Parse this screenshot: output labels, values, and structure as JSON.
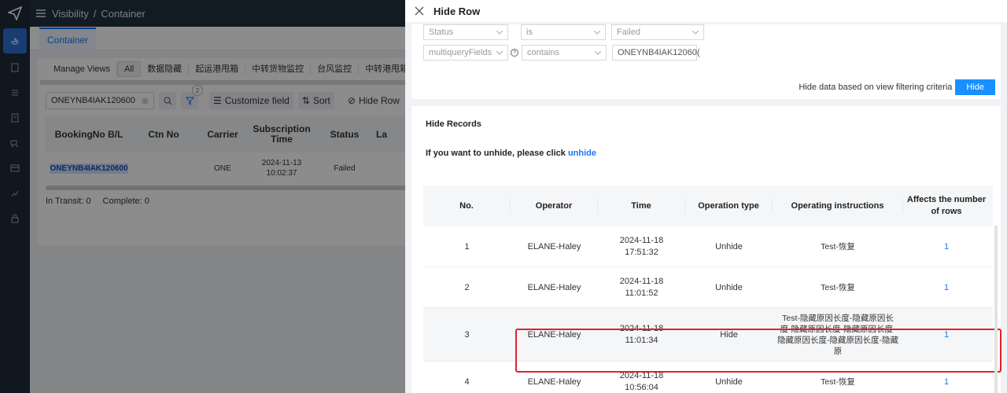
{
  "rail": {
    "icons": [
      "logo-plane-icon",
      "ship-icon",
      "document-icon",
      "list-icon",
      "file-icon",
      "truck-icon",
      "table-icon",
      "chart-icon",
      "lock-icon"
    ]
  },
  "topbar": {
    "breadcrumb_root": "Visibility",
    "separator": "/",
    "breadcrumb_current": "Container"
  },
  "page": {
    "tab": "Container",
    "views": [
      "Manage Views",
      "All",
      "数据隐藏",
      "起运港甩箱",
      "中转货物监控",
      "台风监控",
      "中转港甩箱"
    ],
    "search_value": "ONEYNB4IAK120600",
    "filter_badge": "2",
    "toolbar": {
      "customize": "Customize field",
      "sort": "Sort",
      "hide_row": "Hide Row"
    },
    "columns": [
      "BookingNo B/L",
      "Ctn No",
      "Carrier",
      "Subscription Time",
      "Status",
      "La"
    ],
    "row": {
      "booking": "ONEYNB4IAK120600",
      "ctn": "",
      "carrier": "ONE",
      "sub_date": "2024-11-13",
      "sub_time": "10:02:37",
      "status": "Failed"
    },
    "summary": {
      "in_transit_label": "In Transit:",
      "in_transit": "0",
      "complete_label": "Complete:",
      "complete": "0"
    }
  },
  "drawer": {
    "title": "Hide Row",
    "filter1": {
      "field": "Status",
      "op": "is",
      "value": "Failed"
    },
    "filter2": {
      "field": "multiqueryFields",
      "op": "contains",
      "value": "ONEYNB4IAK12060("
    },
    "hide_hint": "Hide data based on view filtering criteria",
    "hide_btn": "Hide",
    "records_title": "Hide Records",
    "unhide_text": "If you want to unhide, please click",
    "unhide_link": "unhide",
    "table": {
      "headers": [
        "No.",
        "Operator",
        "Time",
        "Operation type",
        "Operating instructions",
        "Affects the number of rows"
      ],
      "rows": [
        {
          "no": "1",
          "operator": "ELANE-Haley",
          "date": "2024-11-18",
          "time": "17:51:32",
          "type": "Unhide",
          "instr": "Test-恢复",
          "rows": "1"
        },
        {
          "no": "2",
          "operator": "ELANE-Haley",
          "date": "2024-11-18",
          "time": "11:01:52",
          "type": "Unhide",
          "instr": "Test-恢复",
          "rows": "1"
        },
        {
          "no": "3",
          "operator": "ELANE-Haley",
          "date": "2024-11-18",
          "time": "11:01:34",
          "type": "Hide",
          "instr": "Test-隐藏原因长度-隐藏原因长度-隐藏原因长度-隐藏原因长度-隐藏原因长度-隐藏原因长度-隐藏原",
          "rows": "1"
        },
        {
          "no": "4",
          "operator": "ELANE-Haley",
          "date": "2024-11-18",
          "time": "10:56:04",
          "type": "Unhide",
          "instr": "Test-恢复",
          "rows": "1"
        }
      ]
    }
  },
  "colors": {
    "accent": "#1677ff",
    "highlight_border": "#e3202a",
    "rail_bg": "#1f2a3a"
  }
}
